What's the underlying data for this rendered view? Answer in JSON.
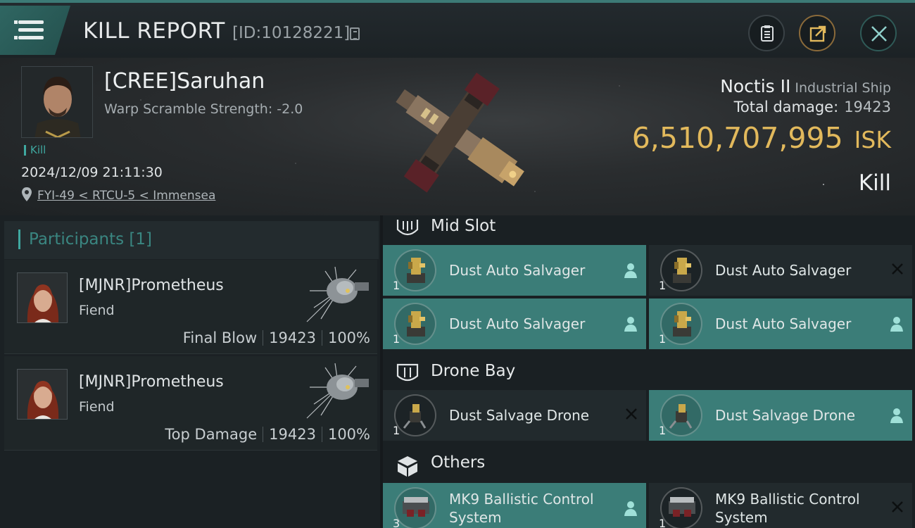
{
  "header": {
    "title": "KILL REPORT",
    "report_id": "[ID:10128221]"
  },
  "victim": {
    "name": "[CREE]Saruhan",
    "warp_scramble": "Warp Scramble Strength: -2.0",
    "tag": "Kill",
    "datetime": "2024/12/09 21:11:30",
    "location": "FYI-49 < RTCU-5 < Immensea",
    "ship_name": "Noctis II",
    "ship_class": "Industrial Ship",
    "total_damage_label": "Total damage:",
    "total_damage_value": "19423",
    "isk_value": "6,510,707,995",
    "isk_unit": "ISK",
    "result": "Kill"
  },
  "participants": {
    "title": "Participants [1]",
    "rows": [
      {
        "name": "[MJNR]Prometheus",
        "ship": "Fiend",
        "role": "Final Blow",
        "damage": "19423",
        "percent": "100%"
      },
      {
        "name": "[MJNR]Prometheus",
        "ship": "Fiend",
        "role": "Top Damage",
        "damage": "19423",
        "percent": "100%"
      }
    ]
  },
  "fitting": {
    "mid_slot": {
      "title": "Mid Slot",
      "items": [
        {
          "name": "Dust Auto Salvager",
          "qty": "1",
          "status": "dropped"
        },
        {
          "name": "Dust Auto Salvager",
          "qty": "1",
          "status": "destroyed"
        },
        {
          "name": "Dust Auto Salvager",
          "qty": "1",
          "status": "dropped"
        },
        {
          "name": "Dust Auto Salvager",
          "qty": "1",
          "status": "dropped"
        }
      ]
    },
    "drone_bay": {
      "title": "Drone Bay",
      "items": [
        {
          "name": "Dust Salvage Drone",
          "qty": "1",
          "status": "destroyed"
        },
        {
          "name": "Dust Salvage Drone",
          "qty": "1",
          "status": "dropped"
        }
      ]
    },
    "others": {
      "title": "Others",
      "items": [
        {
          "name": "MK9 Ballistic Control System",
          "qty": "3",
          "status": "dropped"
        },
        {
          "name": "MK9 Ballistic Control System",
          "qty": "1",
          "status": "destroyed"
        }
      ]
    }
  },
  "colors": {
    "accent_teal": "#3b7d78",
    "isk_gold": "#e2b95c",
    "panel_dark": "#1b2124"
  },
  "icons": [
    "menu-icon",
    "copy-icon",
    "clipboard-icon",
    "share-icon",
    "close-icon",
    "location-pin-icon",
    "mid-slot-icon",
    "drone-bay-icon",
    "cargo-box-icon",
    "person-icon",
    "x-icon"
  ]
}
